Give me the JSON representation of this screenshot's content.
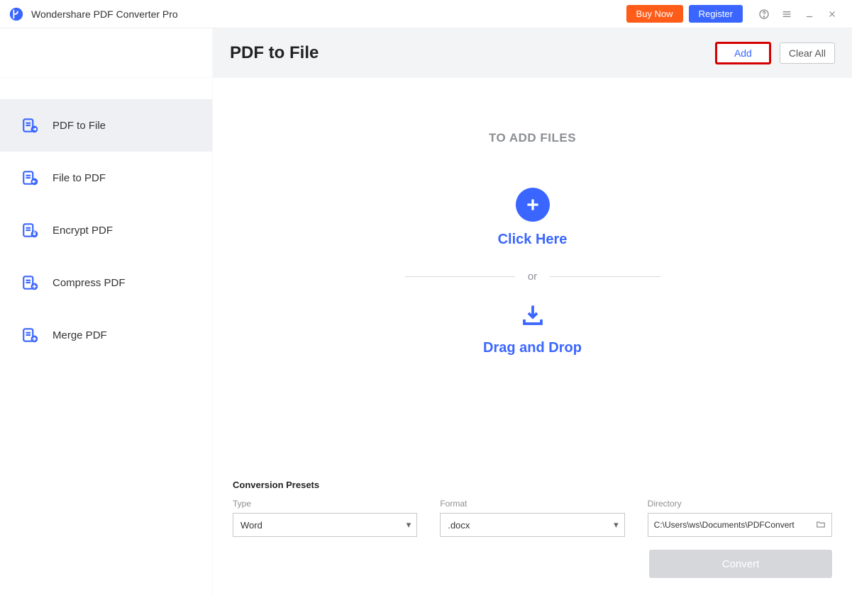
{
  "titlebar": {
    "app_name": "Wondershare PDF Converter Pro",
    "buy_label": "Buy Now",
    "register_label": "Register"
  },
  "header": {
    "title": "PDF to File",
    "add_label": "Add",
    "clear_label": "Clear All"
  },
  "sidebar": {
    "items": [
      {
        "label": "PDF to File"
      },
      {
        "label": "File to PDF"
      },
      {
        "label": "Encrypt PDF"
      },
      {
        "label": "Compress PDF"
      },
      {
        "label": "Merge PDF"
      }
    ]
  },
  "dropzone": {
    "title": "TO ADD FILES",
    "click_label": "Click Here",
    "or_label": "or",
    "drag_label": "Drag and Drop"
  },
  "presets": {
    "title": "Conversion Presets",
    "type_label": "Type",
    "type_value": "Word",
    "format_label": "Format",
    "format_value": ".docx",
    "directory_label": "Directory",
    "directory_value": "C:\\Users\\ws\\Documents\\PDFConvert",
    "convert_label": "Convert"
  }
}
